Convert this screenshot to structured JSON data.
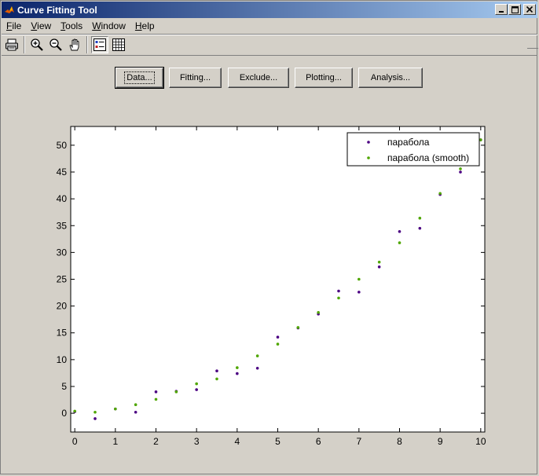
{
  "window": {
    "title": "Curve Fitting Tool",
    "controls": [
      "minimize",
      "maximize",
      "close"
    ]
  },
  "menubar": [
    {
      "label": "File",
      "mnemonic": "F",
      "rest": "ile"
    },
    {
      "label": "View",
      "mnemonic": "V",
      "rest": "iew"
    },
    {
      "label": "Tools",
      "mnemonic": "T",
      "rest": "ools"
    },
    {
      "label": "Window",
      "mnemonic": "W",
      "rest": "indow"
    },
    {
      "label": "Help",
      "mnemonic": "H",
      "rest": "elp"
    }
  ],
  "toolbar": {
    "icons": [
      "print-icon",
      "zoom-in-icon",
      "zoom-out-icon",
      "pan-hand-icon",
      "legend-toggle-icon",
      "grid-toggle-icon"
    ],
    "legend_pressed": true
  },
  "buttons": {
    "data": "Data...",
    "fitting": "Fitting...",
    "exclude": "Exclude...",
    "plotting": "Plotting...",
    "analysis": "Analysis..."
  },
  "chart_data": {
    "type": "scatter",
    "title": "",
    "xlabel": "",
    "ylabel": "",
    "xlim": [
      -0.1,
      10.1
    ],
    "ylim": [
      -3.5,
      53.5
    ],
    "xticks": [
      0,
      1,
      2,
      3,
      4,
      5,
      6,
      7,
      8,
      9,
      10
    ],
    "yticks": [
      0,
      5,
      10,
      15,
      20,
      25,
      30,
      35,
      40,
      45,
      50
    ],
    "grid": false,
    "legend_position": "top-right",
    "series": [
      {
        "name": "парабола",
        "color": "#4b0082",
        "x": [
          0,
          0.5,
          1,
          1.5,
          2,
          2.5,
          3,
          3.5,
          4,
          4.5,
          5,
          5.5,
          6,
          6.5,
          7,
          7.5,
          8,
          8.5,
          9,
          9.5,
          10
        ],
        "y": [
          0.3,
          -1.0,
          0.8,
          0.2,
          4.0,
          4.1,
          4.4,
          7.9,
          7.4,
          8.4,
          14.2,
          15.9,
          18.5,
          22.8,
          22.6,
          27.3,
          33.9,
          34.5,
          40.8,
          45.0,
          51.0
        ]
      },
      {
        "name": "парабола (smooth)",
        "color": "#4fa600",
        "x": [
          0,
          0.5,
          1,
          1.5,
          2,
          2.5,
          3,
          3.5,
          4,
          4.5,
          5,
          5.5,
          6,
          6.5,
          7,
          7.5,
          8,
          8.5,
          9,
          9.5,
          10
        ],
        "y": [
          0.4,
          0.2,
          0.8,
          1.6,
          2.6,
          4.0,
          5.5,
          6.4,
          8.5,
          10.7,
          12.9,
          16.0,
          18.8,
          21.5,
          25.0,
          28.2,
          31.8,
          36.4,
          41.0,
          45.6,
          51.0
        ]
      }
    ]
  }
}
